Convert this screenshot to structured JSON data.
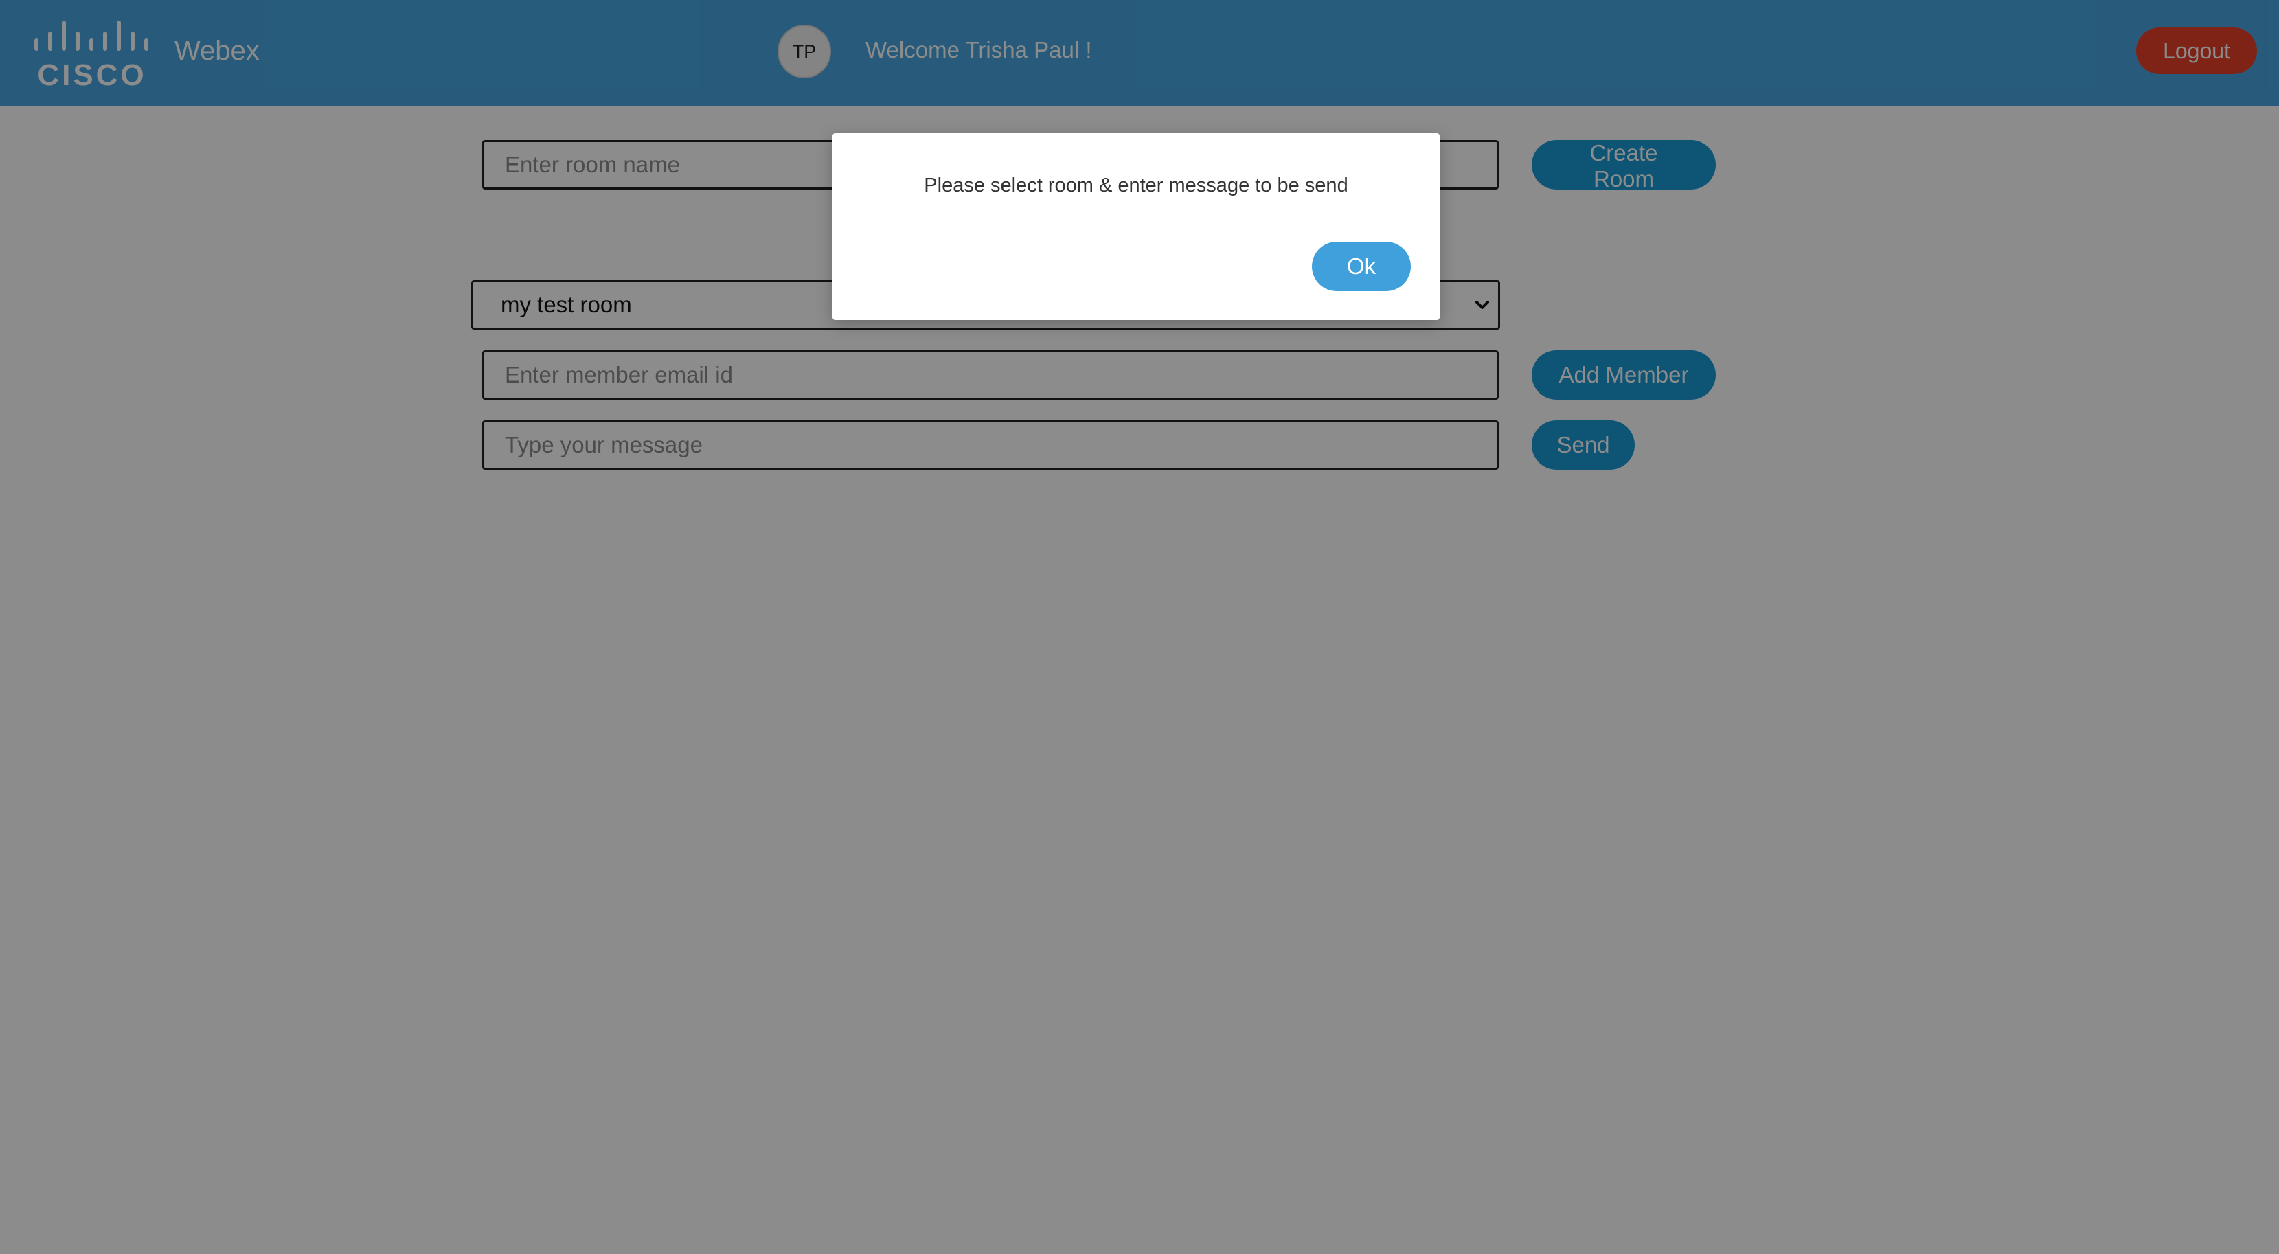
{
  "header": {
    "brand_name": "Webex",
    "logo_text": "CISCO",
    "avatar_initials": "TP",
    "welcome_text": "Welcome Trisha Paul !",
    "logout_label": "Logout"
  },
  "form": {
    "room_name_placeholder": "Enter room name",
    "create_room_label": "Create Room",
    "selected_room": "my test room",
    "member_email_placeholder": "Enter member email id",
    "add_member_label": "Add Member",
    "message_placeholder": "Type your message",
    "send_label": "Send"
  },
  "dialog": {
    "message": "Please select room & enter message to be send",
    "ok_label": "Ok"
  },
  "icons": {
    "select_arrow": "chevron-down-icon"
  },
  "colors": {
    "header_bg": "#49a7e1",
    "primary_button": "#1a9ad6",
    "logout_button": "#e8402a"
  }
}
